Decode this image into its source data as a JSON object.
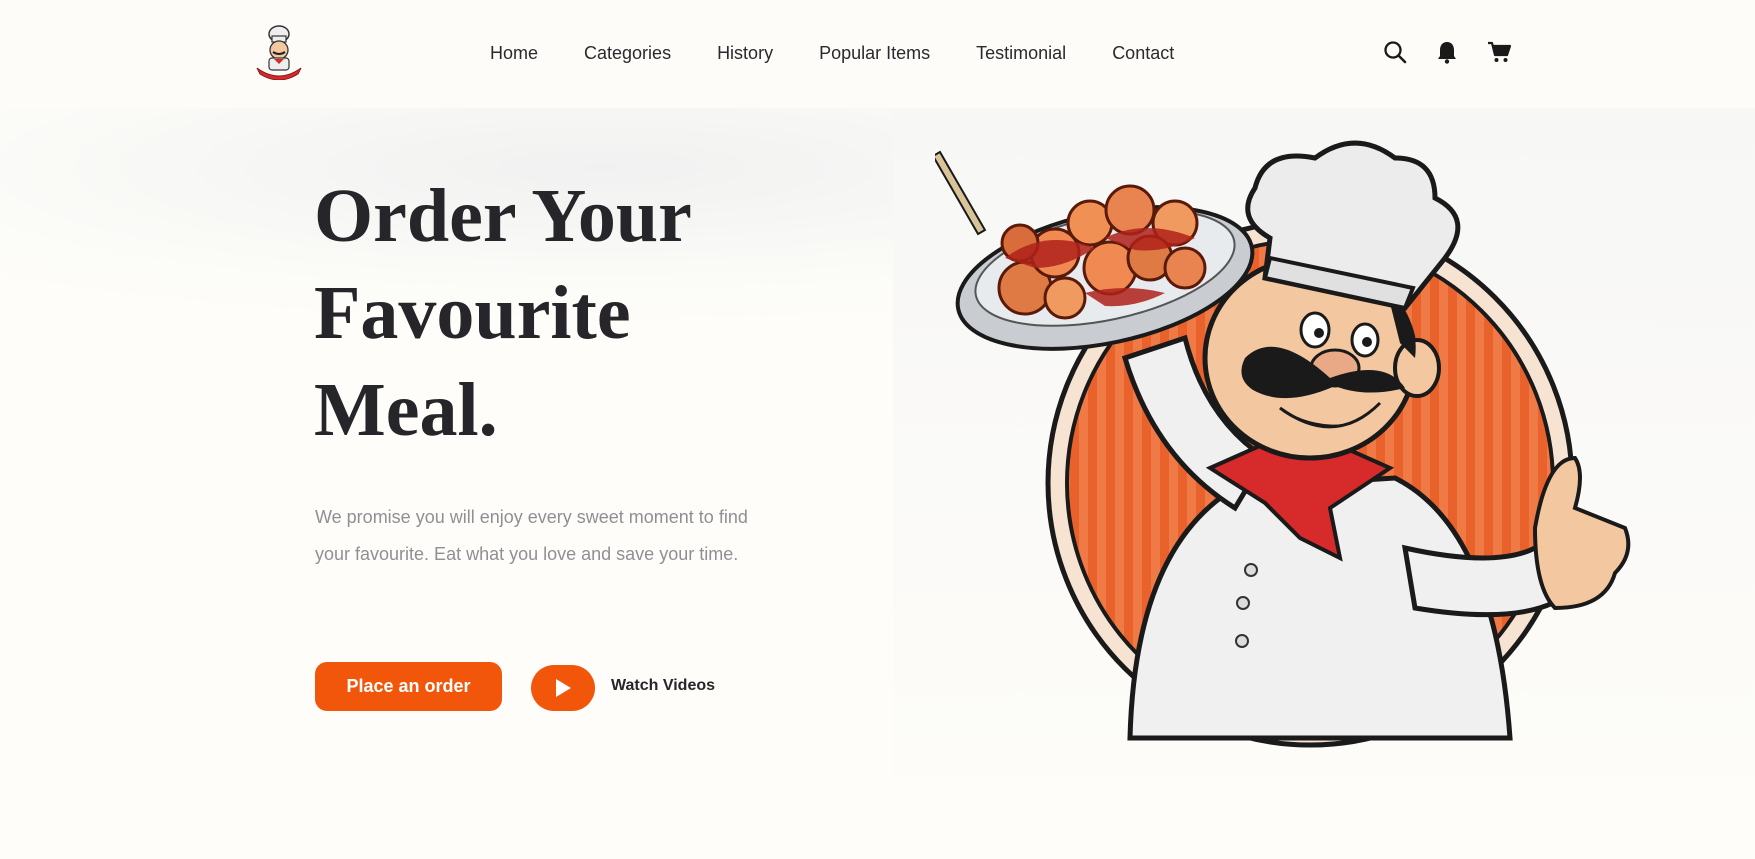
{
  "nav": {
    "links": [
      "Home",
      "Categories",
      "History",
      "Popular Items",
      "Testimonial",
      "Contact"
    ],
    "icons": [
      "search-icon",
      "bell-icon",
      "cart-icon"
    ]
  },
  "hero": {
    "headline": [
      "Order Your",
      "Favourite",
      "Meal."
    ],
    "subtitle": "We promise you will enjoy every sweet moment to find your favourite. Eat what you love and save your time.",
    "order_button": "Place an order",
    "watch_label": "Watch Videos"
  },
  "colors": {
    "accent": "#f1560b",
    "text_dark": "#26262a",
    "text_muted": "#8f8f95",
    "background": "#fefdf9"
  }
}
